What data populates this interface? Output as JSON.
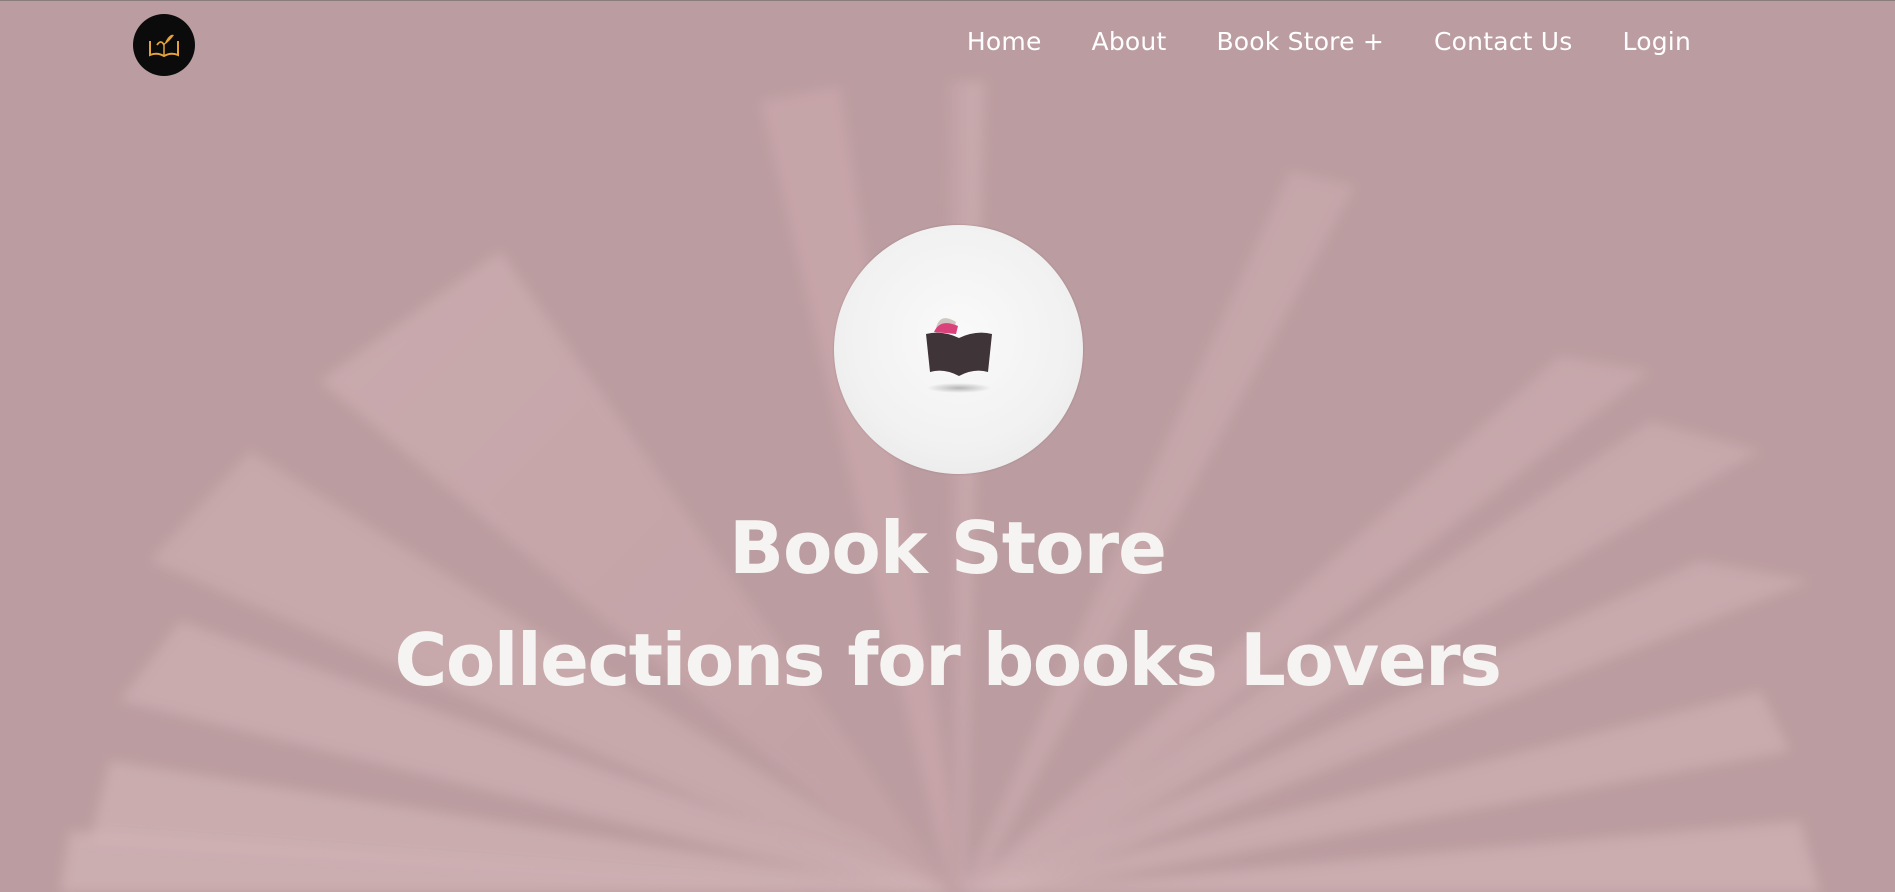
{
  "nav": {
    "logo_icon": "book-leaf-logo",
    "links": [
      {
        "label": "Home"
      },
      {
        "label": "About"
      },
      {
        "label": "Book Store +"
      },
      {
        "label": "Contact Us"
      },
      {
        "label": "Login"
      }
    ]
  },
  "hero": {
    "emblem_icon": "open-book-icon",
    "title": "Book Store",
    "subtitle": "Collections for books Lovers"
  },
  "colors": {
    "background_overlay": "#bb9da0",
    "text": "#ffffff",
    "logo_bg": "#0b0b0b",
    "logo_accent": "#e3a23a",
    "emblem_book": "#3f3438",
    "emblem_pink": "#d9427a"
  }
}
